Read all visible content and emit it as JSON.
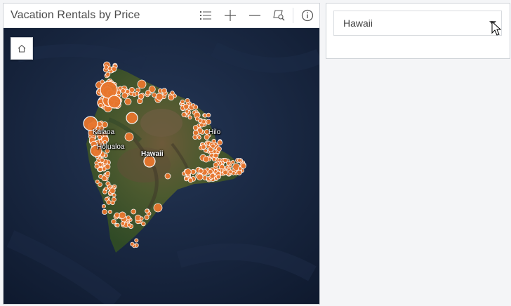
{
  "map_card": {
    "title": "Vacation Rentals by Price",
    "tools": [
      {
        "name": "legend-list-icon"
      },
      {
        "name": "zoom-in-icon"
      },
      {
        "name": "zoom-out-icon"
      },
      {
        "name": "search-extent-icon"
      },
      {
        "name": "info-icon"
      }
    ],
    "home_icon": "home-icon"
  },
  "map": {
    "places": [
      {
        "label": "Kalaoa",
        "bold": false
      },
      {
        "label": "Holualoa",
        "bold": false
      },
      {
        "label": "Hilo",
        "bold": false
      },
      {
        "label": "Hawaii",
        "bold": true
      }
    ],
    "marker_color": "#e8762d",
    "marker_stroke": "#ffffff",
    "ocean_color": "#142038"
  },
  "panel": {
    "selected_region": "Hawaii"
  }
}
